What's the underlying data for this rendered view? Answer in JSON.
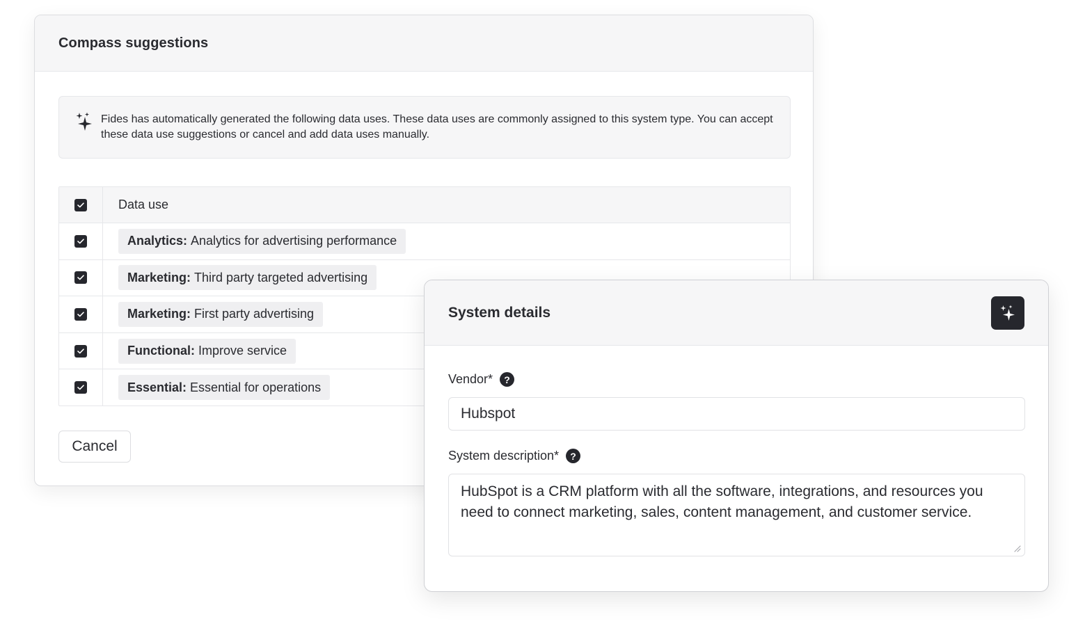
{
  "compass": {
    "title": "Compass suggestions",
    "info_text": "Fides has automatically generated the following data uses. These data uses are commonly assigned to this system type. You can accept these data use suggestions or cancel and add data uses manually.",
    "table": {
      "header": "Data use",
      "rows": [
        {
          "category": "Analytics:",
          "description": "Analytics for advertising performance",
          "checked": true
        },
        {
          "category": "Marketing:",
          "description": "Third party targeted advertising",
          "checked": true
        },
        {
          "category": "Marketing:",
          "description": "First party advertising",
          "checked": true
        },
        {
          "category": "Functional:",
          "description": "Improve service",
          "checked": true
        },
        {
          "category": "Essential:",
          "description": "Essential for operations",
          "checked": true
        }
      ]
    },
    "cancel_label": "Cancel"
  },
  "system": {
    "title": "System details",
    "vendor_label": "Vendor*",
    "vendor_value": "Hubspot",
    "description_label": "System description*",
    "description_value": "HubSpot is a CRM platform with all the software, integrations, and resources you need to connect marketing, sales, content management, and customer service.",
    "help_glyph": "?"
  },
  "icons": {
    "info": "sparkles-icon",
    "magic_button": "sparkles-icon",
    "help": "question-circle-icon",
    "checkbox": "checkmark-icon"
  },
  "colors": {
    "dark": "#26272d",
    "header_bg": "#f6f6f7",
    "tag_bg": "#efeff1",
    "border": "#e6e7ea"
  }
}
